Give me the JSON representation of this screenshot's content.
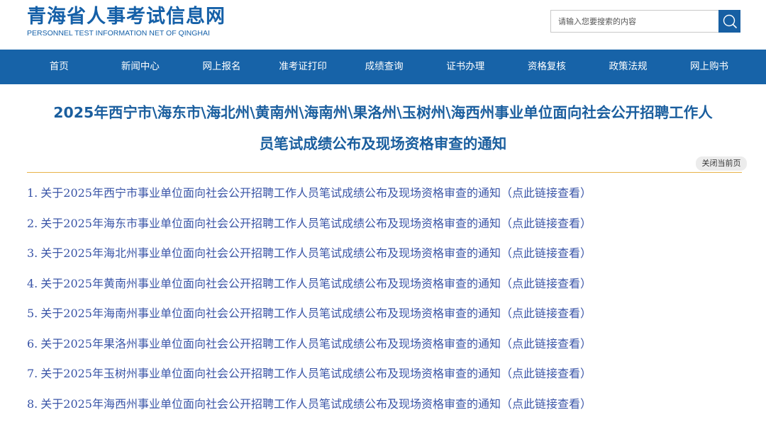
{
  "site": {
    "name_cn": "青海省人事考试信息网",
    "name_en": "PERSONNEL TEST INFORMATION NET OF QINGHAI"
  },
  "search": {
    "placeholder": "请输入您要搜索的内容",
    "button_icon": "search-icon"
  },
  "nav": [
    {
      "label": "首页"
    },
    {
      "label": "新闻中心"
    },
    {
      "label": "网上报名"
    },
    {
      "label": "准考证打印"
    },
    {
      "label": "成绩查询"
    },
    {
      "label": "证书办理"
    },
    {
      "label": "资格复核"
    },
    {
      "label": "政策法规"
    },
    {
      "label": "网上购书"
    }
  ],
  "article": {
    "title_line1": "2025年西宁市\\海东市\\海北州\\黄南州\\海南州\\果洛州\\玉树州\\海西州事业单位面向社会公开招聘工作人",
    "title_line2": "员笔试成绩公布及现场资格审查的通知",
    "close_label": "关闭当前页",
    "links": [
      {
        "num": "1.",
        "text": "关于2025年西宁市事业单位面向社会公开招聘工作人员笔试成绩公布及现场资格审查的通知（点此链接查看）"
      },
      {
        "num": "2.",
        "text": "关于2025年海东市事业单位面向社会公开招聘工作人员笔试成绩公布及现场资格审查的通知（点此链接查看）"
      },
      {
        "num": "3.",
        "text": "关于2025年海北州事业单位面向社会公开招聘工作人员笔试成绩公布及现场资格审查的通知（点此链接查看）"
      },
      {
        "num": "4.",
        "text": "关于2025年黄南州事业单位面向社会公开招聘工作人员笔试成绩公布及现场资格审查的通知（点此链接查看）"
      },
      {
        "num": "5.",
        "text": "关于2025年海南州事业单位面向社会公开招聘工作人员笔试成绩公布及现场资格审查的通知（点此链接查看）"
      },
      {
        "num": "6.",
        "text": "关于2025年果洛州事业单位面向社会公开招聘工作人员笔试成绩公布及现场资格审查的通知（点此链接查看）"
      },
      {
        "num": "7.",
        "text": "关于2025年玉树州事业单位面向社会公开招聘工作人员笔试成绩公布及现场资格审查的通知（点此链接查看）"
      },
      {
        "num": "8.",
        "text": "关于2025年海西州事业单位面向社会公开招聘工作人员笔试成绩公布及现场资格审查的通知（点此链接查看）"
      }
    ]
  },
  "colors": {
    "brand_blue": "#1763a8",
    "title_blue": "#1a5e9e",
    "link_blue": "#3a55a7",
    "divider_gold": "#e8b24a"
  }
}
